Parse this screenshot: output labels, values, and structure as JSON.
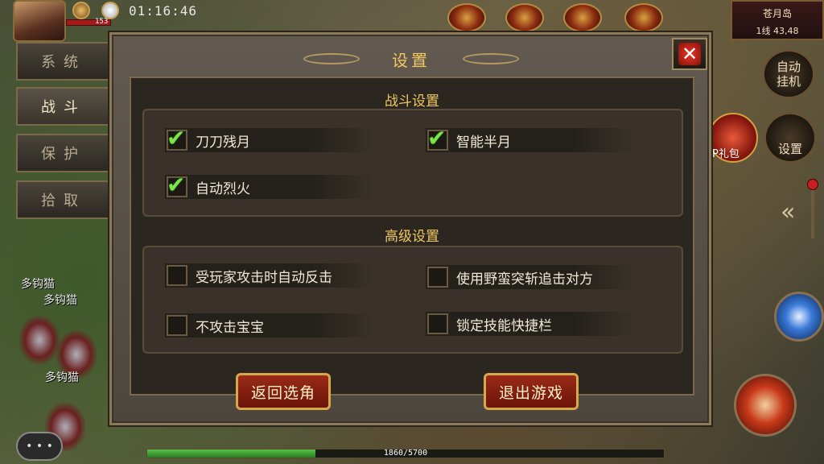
{
  "hud": {
    "clock": "01:16:46",
    "hp_text": "153",
    "map_name": "苍月岛",
    "map_coord": "1线 43,48",
    "exp_text": "1860/5700",
    "exp_progress": 0.326,
    "chat_icon": "speech-bubble-icon"
  },
  "side_tabs": [
    {
      "label": "系统",
      "active": false
    },
    {
      "label": "战斗",
      "active": true
    },
    {
      "label": "保护",
      "active": false
    },
    {
      "label": "拾取",
      "active": false
    }
  ],
  "right_hud": {
    "auto_hunt_label": "自动\n挂机",
    "vip_label": "P礼包",
    "settings_label": "设置"
  },
  "mobs": {
    "names": [
      "多钩猫",
      "多钩猫",
      "多钩猫"
    ]
  },
  "dialog": {
    "title": "设置",
    "close_icon": "close-x-icon",
    "combat_section": {
      "title": "战斗设置",
      "options": [
        {
          "label": "刀刀残月",
          "checked": true
        },
        {
          "label": "智能半月",
          "checked": true
        },
        {
          "label": "自动烈火",
          "checked": true
        }
      ]
    },
    "advanced_section": {
      "title": "高级设置",
      "options": [
        {
          "label": "受玩家攻击时自动反击",
          "checked": false
        },
        {
          "label": "使用野蛮突斩追击对方",
          "checked": false
        },
        {
          "label": "不攻击宝宝",
          "checked": false
        },
        {
          "label": "锁定技能快捷栏",
          "checked": false
        }
      ]
    },
    "buttons": {
      "back": "返回选角",
      "exit": "退出游戏"
    }
  }
}
